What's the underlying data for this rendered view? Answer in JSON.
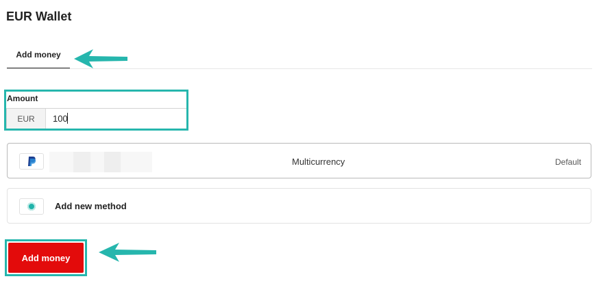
{
  "header": {
    "title": "EUR Wallet"
  },
  "tabs": [
    {
      "label": "Add money",
      "active": true
    }
  ],
  "amount": {
    "label": "Amount",
    "currency": "EUR",
    "value": "100"
  },
  "payment_methods": [
    {
      "icon": "paypal-icon",
      "name": "Multicurrency",
      "badge": "Default"
    }
  ],
  "add_method": {
    "icon": "add-method-icon",
    "label": "Add new method"
  },
  "actions": {
    "submit_label": "Add money"
  },
  "colors": {
    "accent": "#e30b0b",
    "highlight": "#26b6ad"
  }
}
